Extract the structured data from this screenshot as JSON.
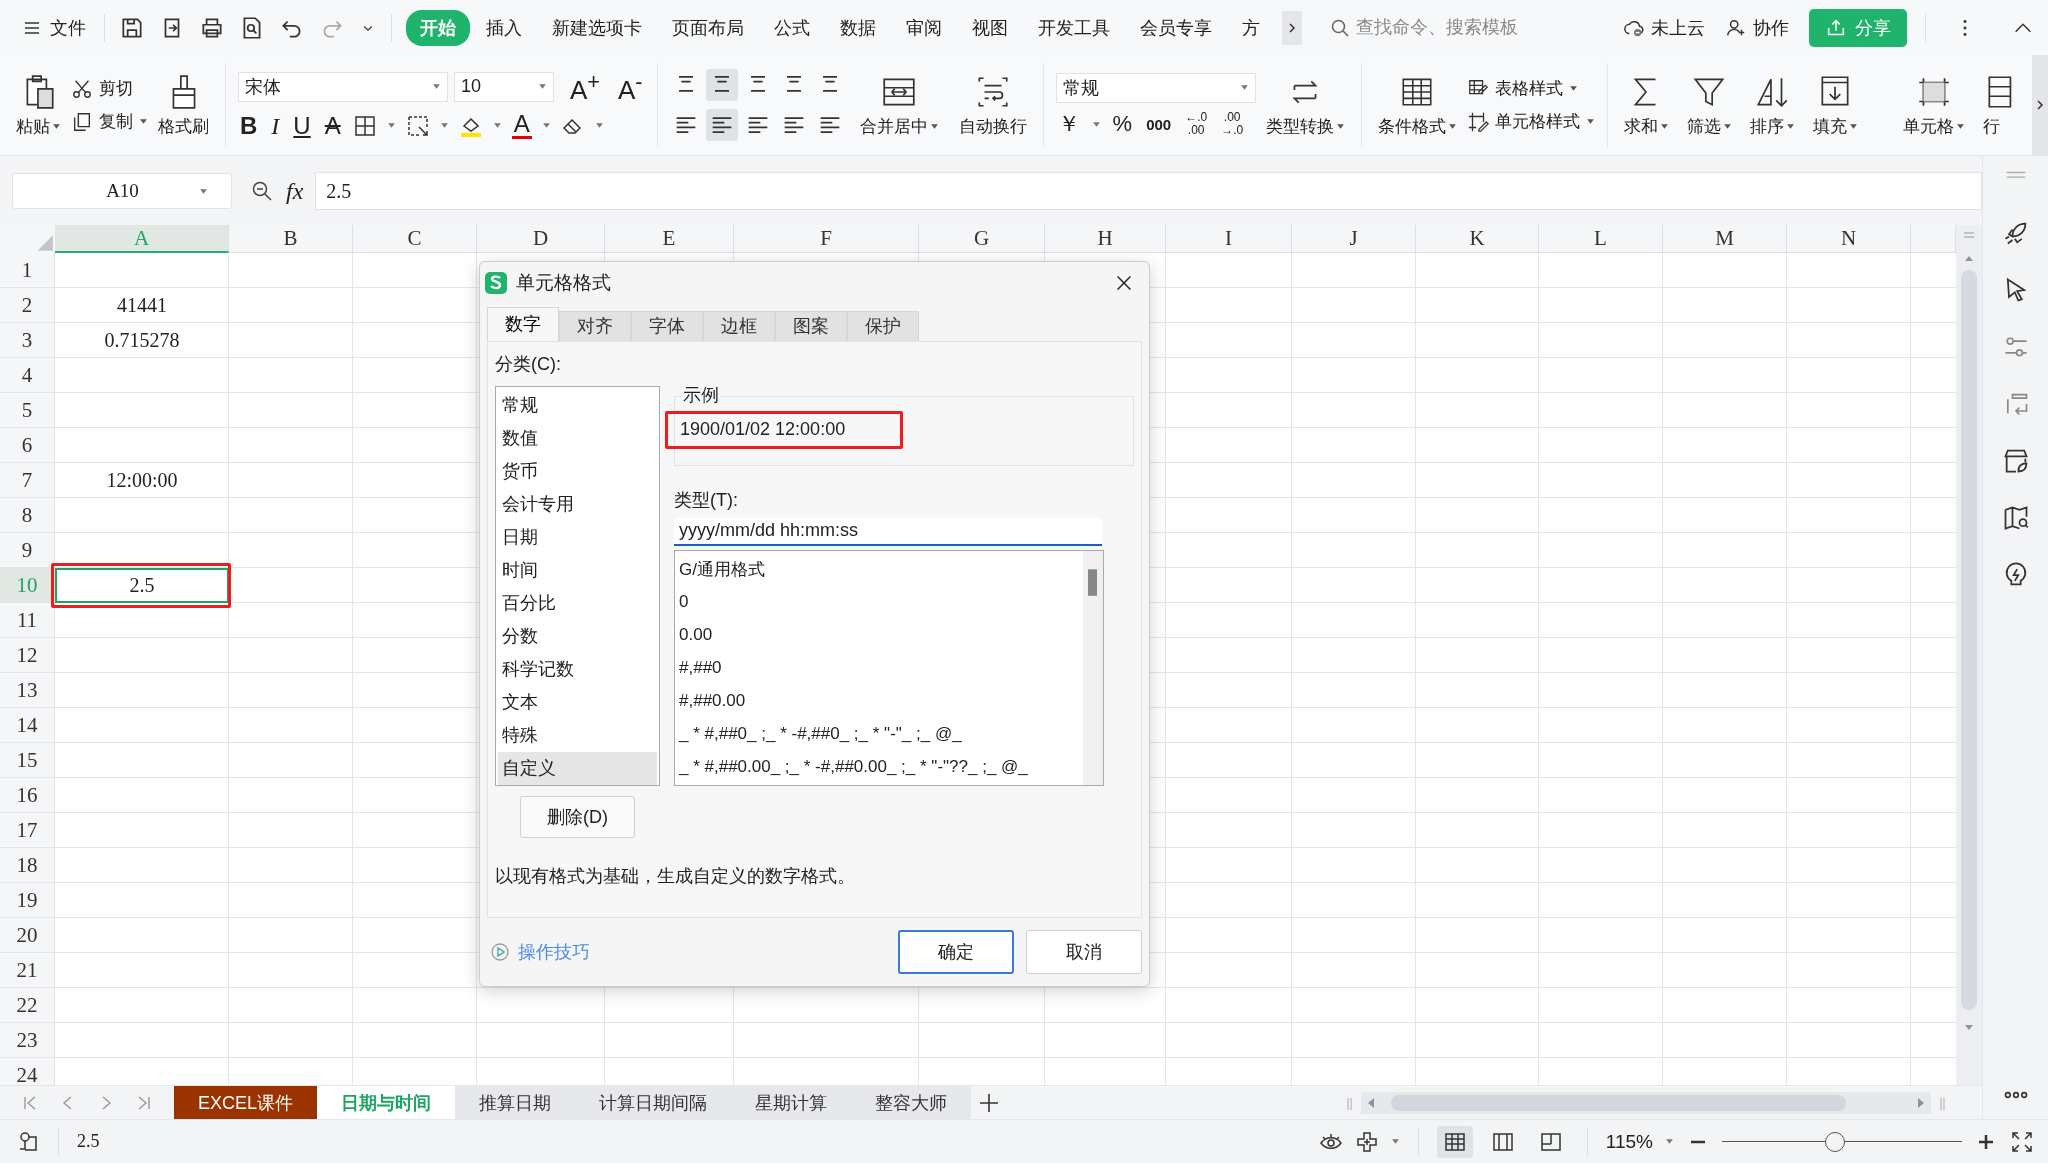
{
  "menu_bar": {
    "file": "文件",
    "tabs": [
      {
        "label": "开始",
        "selected": true
      },
      {
        "label": "插入",
        "selected": false
      },
      {
        "label": "新建选项卡",
        "selected": false
      },
      {
        "label": "页面布局",
        "selected": false
      },
      {
        "label": "公式",
        "selected": false
      },
      {
        "label": "数据",
        "selected": false
      },
      {
        "label": "审阅",
        "selected": false
      },
      {
        "label": "视图",
        "selected": false
      },
      {
        "label": "开发工具",
        "selected": false
      },
      {
        "label": "会员专享",
        "selected": false
      },
      {
        "label": "方",
        "selected": false
      }
    ],
    "search": {
      "placeholder": "查找命令、搜索模板"
    },
    "cloud": "未上云",
    "collaborate": "协作",
    "share": "分享"
  },
  "ribbon": {
    "paste": "粘贴",
    "cut": "剪切",
    "copy": "复制",
    "format_painter": "格式刷",
    "font_name": "宋体",
    "font_size": "10",
    "grow_font": "A$^{+}$",
    "shrink_font": "A$^{-}$",
    "bold": "B",
    "italic": "I",
    "underline": "U",
    "strikethrough": "A",
    "font_color": "A",
    "merge_center": "合并居中",
    "wrap_text": "自动换行",
    "number_format": "常规",
    "currency": "￥",
    "percent": "%",
    "thousands": "000",
    "decimal_increase": [
      "←.0",
      ".00"
    ],
    "decimal_decrease": [
      ".00",
      "→.0"
    ],
    "type_convert": "类型转换",
    "conditional_format": "条件格式",
    "table_style": "表格样式",
    "cell_style": "单元格样式",
    "sum": "求和",
    "filter": "筛选",
    "sort": "排序",
    "fill": "填充",
    "cells": "单元格",
    "row_col": "行"
  },
  "formula_bar": {
    "name_box": "A10",
    "fx": "fx",
    "value": "2.5"
  },
  "sheet": {
    "columns": [
      {
        "label": "A",
        "selected": true
      },
      {
        "label": "B",
        "selected": false
      },
      {
        "label": "C",
        "selected": false
      },
      {
        "label": "D",
        "selected": false
      },
      {
        "label": "E",
        "selected": false
      },
      {
        "label": "F",
        "selected": false
      },
      {
        "label": "G",
        "selected": false
      },
      {
        "label": "H",
        "selected": false
      },
      {
        "label": "I",
        "selected": false
      },
      {
        "label": "J",
        "selected": false
      },
      {
        "label": "K",
        "selected": false
      },
      {
        "label": "L",
        "selected": false
      },
      {
        "label": "M",
        "selected": false
      },
      {
        "label": "N",
        "selected": false
      }
    ],
    "rows": [
      {
        "label": "1",
        "selected": false
      },
      {
        "label": "2",
        "selected": false,
        "value": "41441"
      },
      {
        "label": "3",
        "selected": false,
        "value": "0.715278"
      },
      {
        "label": "4",
        "selected": false
      },
      {
        "label": "5",
        "selected": false
      },
      {
        "label": "6",
        "selected": false
      },
      {
        "label": "7",
        "selected": false,
        "value": "12:00:00"
      },
      {
        "label": "8",
        "selected": false
      },
      {
        "label": "9",
        "selected": false
      },
      {
        "label": "10",
        "selected": true,
        "value": "2.5"
      },
      {
        "label": "11",
        "selected": false
      },
      {
        "label": "12",
        "selected": false
      },
      {
        "label": "13",
        "selected": false
      },
      {
        "label": "14",
        "selected": false
      },
      {
        "label": "15",
        "selected": false
      },
      {
        "label": "16",
        "selected": false
      },
      {
        "label": "17",
        "selected": false
      },
      {
        "label": "18",
        "selected": false
      },
      {
        "label": "19",
        "selected": false
      },
      {
        "label": "20",
        "selected": false
      },
      {
        "label": "21",
        "selected": false
      },
      {
        "label": "22",
        "selected": false
      },
      {
        "label": "23",
        "selected": false
      },
      {
        "label": "24",
        "selected": false
      }
    ],
    "active_cell_marked": true
  },
  "dialog": {
    "title": "单元格格式",
    "tabs": [
      {
        "label": "数字",
        "selected": true
      },
      {
        "label": "对齐",
        "selected": false
      },
      {
        "label": "字体",
        "selected": false
      },
      {
        "label": "边框",
        "selected": false
      },
      {
        "label": "图案",
        "selected": false
      },
      {
        "label": "保护",
        "selected": false
      }
    ],
    "category_label": "分类(C):",
    "categories": [
      {
        "label": "常规",
        "selected": false
      },
      {
        "label": "数值",
        "selected": false
      },
      {
        "label": "货币",
        "selected": false
      },
      {
        "label": "会计专用",
        "selected": false
      },
      {
        "label": "日期",
        "selected": false
      },
      {
        "label": "时间",
        "selected": false
      },
      {
        "label": "百分比",
        "selected": false
      },
      {
        "label": "分数",
        "selected": false
      },
      {
        "label": "科学记数",
        "selected": false
      },
      {
        "label": "文本",
        "selected": false
      },
      {
        "label": "特殊",
        "selected": false
      },
      {
        "label": "自定义",
        "selected": true
      }
    ],
    "sample_label": "示例",
    "sample": "1900/01/02 12:00:00",
    "sample_marked": true,
    "type_label": "类型(T):",
    "type_value": "yyyy/mm/dd hh:mm:ss",
    "formats": [
      "G/通用格式",
      "0",
      "0.00",
      "#,##0",
      "#,##0.00",
      "_ * #,##0_ ;_ * -#,##0_ ;_ * \"-\"_ ;_ @_",
      "_ * #,##0.00_ ;_ * -#,##0.00_ ;_ * \"-\"??_ ;_ @_"
    ],
    "delete": "删除(D)",
    "description": "以现有格式为基础，生成自定义的数字格式。",
    "tips": "操作技巧",
    "ok": "确定",
    "cancel": "取消"
  },
  "sheet_tabs": [
    {
      "label": "EXCEL课件",
      "selected": false,
      "color": "#9a3300"
    },
    {
      "label": "日期与时间",
      "selected": true,
      "color": "#ffffff"
    },
    {
      "label": "推算日期",
      "selected": false,
      "color": "#e6e8ec"
    },
    {
      "label": "计算日期间隔",
      "selected": false,
      "color": "#e6e8ec"
    },
    {
      "label": "星期计算",
      "selected": false,
      "color": "#e6e8ec"
    },
    {
      "label": "整容大师",
      "selected": false,
      "color": "#e6e8ec"
    }
  ],
  "status_bar": {
    "cell_value": "2.5",
    "view_modes": [
      {
        "selected": true
      },
      {
        "selected": false
      },
      {
        "selected": false
      }
    ],
    "zoom": "115%",
    "zoom_slider": {
      "level": 0.47
    }
  }
}
